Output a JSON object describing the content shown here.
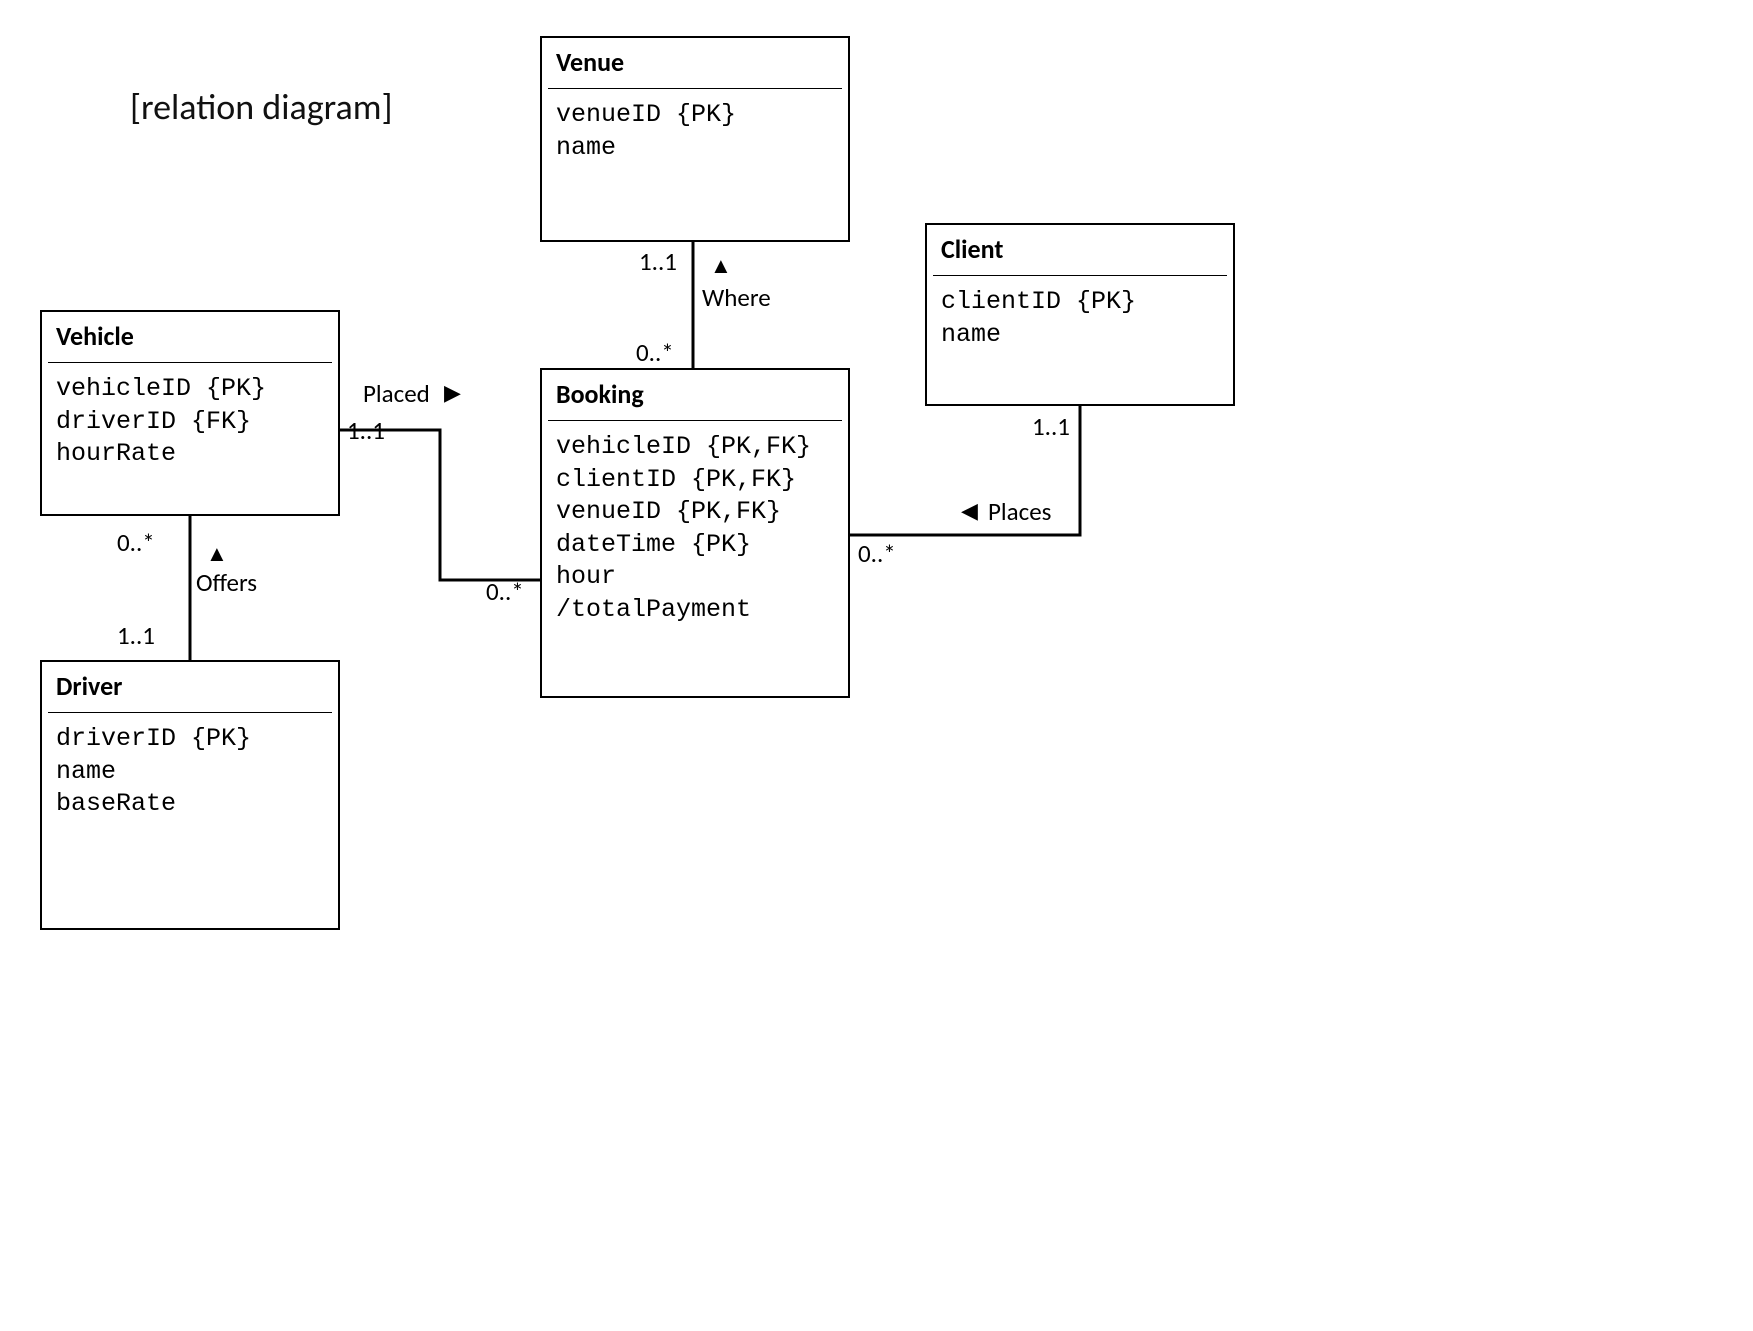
{
  "title": "[relation diagram]",
  "entities": {
    "venue": {
      "name": "Venue",
      "attrs": "venueID {PK}\nname"
    },
    "client": {
      "name": "Client",
      "attrs": "clientID {PK}\nname"
    },
    "vehicle": {
      "name": "Vehicle",
      "attrs": "vehicleID {PK}\ndriverID {FK}\nhourRate"
    },
    "booking": {
      "name": "Booking",
      "attrs": "vehicleID {PK,FK}\nclientID {PK,FK}\nvenueID {PK,FK}\ndateTime {PK}\nhour\n/totalPayment"
    },
    "driver": {
      "name": "Driver",
      "attrs": "driverID {PK}\nname\nbaseRate"
    }
  },
  "relations": {
    "where": {
      "label": "Where",
      "near": "1..1",
      "far": "0..*"
    },
    "placed": {
      "label": "Placed",
      "near": "1..1",
      "far": "0..*"
    },
    "places": {
      "label": "Places",
      "near": "1..1",
      "far": "0..*"
    },
    "offers": {
      "label": "Offers",
      "near": "1..1",
      "far": "0..*"
    }
  }
}
